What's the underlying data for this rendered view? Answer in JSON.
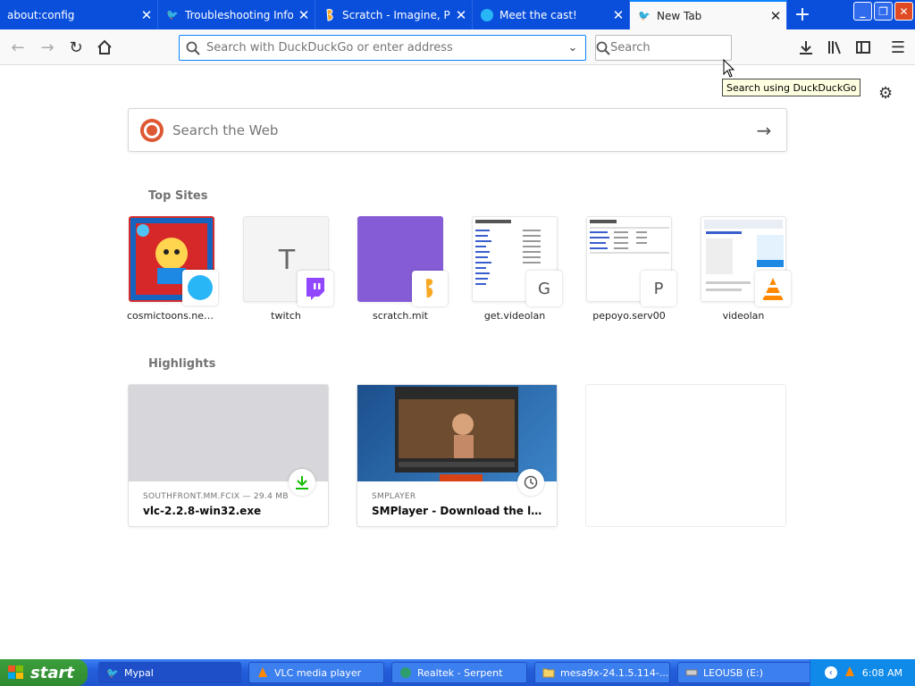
{
  "tabs": [
    {
      "title": "about:config",
      "icon": "none"
    },
    {
      "title": "Troubleshooting Information",
      "icon": "mypal-icon"
    },
    {
      "title": "Scratch - Imagine, Program, Share",
      "icon": "scratch-icon"
    },
    {
      "title": "Meet the cast!",
      "icon": "globe-icon"
    },
    {
      "title": "New Tab",
      "icon": "mypal-icon"
    }
  ],
  "toolbar": {
    "url_placeholder": "Search with DuckDuckGo or enter address",
    "search_placeholder": "Search",
    "search_tooltip": "Search using DuckDuckGo"
  },
  "content": {
    "web_search_placeholder": "Search the Web",
    "top_sites_title": "Top Sites",
    "top_sites": [
      {
        "label": "cosmictoons.neoci…",
        "letter": ""
      },
      {
        "label": "twitch",
        "letter": "T"
      },
      {
        "label": "scratch.mit",
        "letter": ""
      },
      {
        "label": "get.videolan",
        "letter": "G"
      },
      {
        "label": "pepoyo.serv00",
        "letter": "P"
      },
      {
        "label": "videolan",
        "letter": ""
      }
    ],
    "highlights_title": "Highlights",
    "highlights": [
      {
        "meta": "SOUTHFRONT.MM.FCIX — 29.4 MB",
        "title": "vlc-2.2.8-win32.exe"
      },
      {
        "meta": "SMPLAYER",
        "title": "SMPlayer - Download the latest …"
      }
    ]
  },
  "taskbar": {
    "start": "start",
    "tasks": [
      {
        "label": "Mypal"
      },
      {
        "label": "VLC media player"
      },
      {
        "label": "Realtek - Serpent"
      },
      {
        "label": "mesa9x-24.1.5.114-..."
      },
      {
        "label": "LEOUSB (E:)"
      }
    ],
    "clock": "6:08 AM"
  },
  "colors": {
    "tabbar": "#0a4fdc",
    "accent": "#0a84ff",
    "twitch": "#9146ff",
    "scratch_tile": "#855cd6"
  }
}
